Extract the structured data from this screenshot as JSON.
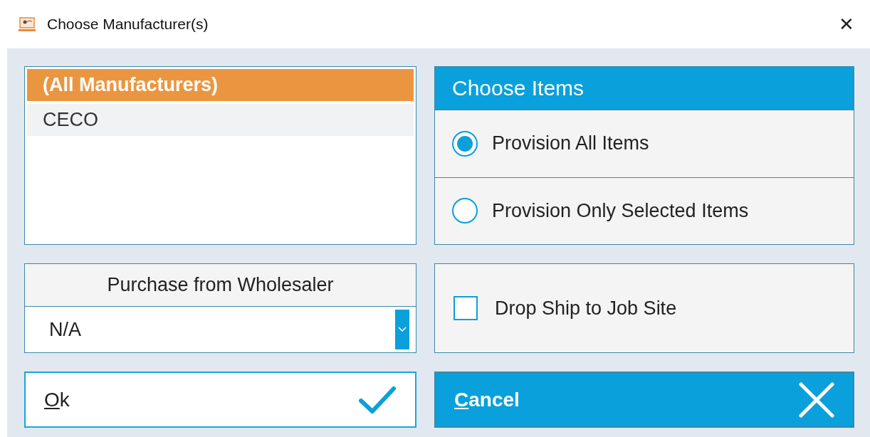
{
  "window": {
    "title": "Choose Manufacturer(s)",
    "close": "✕"
  },
  "manufacturers": [
    {
      "label": "(All Manufacturers)",
      "selected": true
    },
    {
      "label": "CECO",
      "selected": false
    }
  ],
  "wholesaler": {
    "title": "Purchase from Wholesaler",
    "value": "N/A"
  },
  "choose_items": {
    "title": "Choose Items",
    "options": [
      {
        "label": "Provision All Items",
        "selected": true
      },
      {
        "label": "Provision Only Selected Items",
        "selected": false
      }
    ]
  },
  "drop_ship": {
    "label": "Drop Ship to Job Site",
    "checked": false
  },
  "buttons": [
    {
      "kind": "ok",
      "label": "Ok",
      "mnemonic": true
    },
    {
      "kind": "cancel",
      "label": "Cancel",
      "mnemonic": true
    }
  ]
}
